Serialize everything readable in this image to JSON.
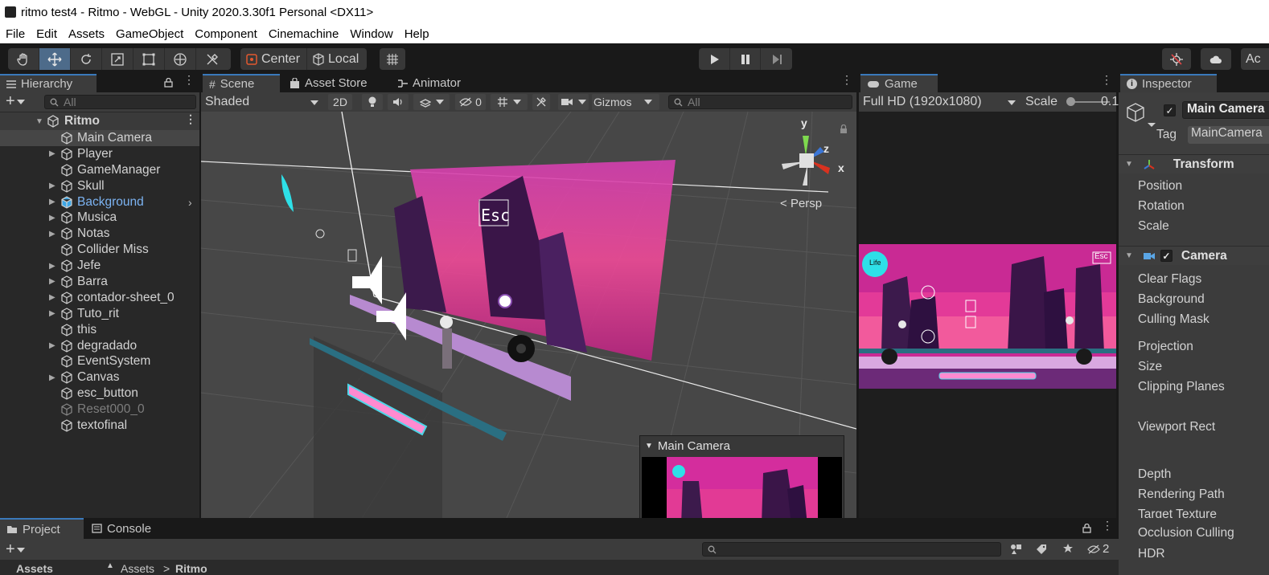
{
  "window": {
    "title": "ritmo test4 - Ritmo - WebGL - Unity 2020.3.30f1 Personal <DX11>"
  },
  "menu": [
    "File",
    "Edit",
    "Assets",
    "GameObject",
    "Component",
    "Cinemachine",
    "Window",
    "Help"
  ],
  "toolbar": {
    "tools": [
      "hand-tool",
      "move-tool",
      "rotate-tool",
      "scale-tool",
      "rect-tool",
      "transform-tool",
      "custom-tool"
    ],
    "active_tool": "move-tool",
    "pivot_label": "Center",
    "space_label": "Local",
    "account_label": "Ac"
  },
  "hierarchy": {
    "tab": "Hierarchy",
    "search_placeholder": "All",
    "scene": "Ritmo",
    "items": [
      {
        "label": "Main Camera",
        "fold": false
      },
      {
        "label": "Player",
        "fold": true
      },
      {
        "label": "GameManager",
        "fold": false
      },
      {
        "label": "Skull",
        "fold": true
      },
      {
        "label": "Background",
        "fold": true
      },
      {
        "label": "Musica",
        "fold": true
      },
      {
        "label": "Notas",
        "fold": true
      },
      {
        "label": "Collider Miss",
        "fold": false
      },
      {
        "label": "Jefe",
        "fold": true
      },
      {
        "label": "Barra",
        "fold": true
      },
      {
        "label": "contador-sheet_0",
        "fold": true
      },
      {
        "label": "Tuto_rit",
        "fold": true
      },
      {
        "label": "this",
        "fold": false
      },
      {
        "label": "degradado",
        "fold": true
      },
      {
        "label": "EventSystem",
        "fold": false
      },
      {
        "label": "Canvas",
        "fold": true
      },
      {
        "label": "esc_button",
        "fold": false
      },
      {
        "label": "Reset000_0",
        "fold": false
      },
      {
        "label": "textofinal",
        "fold": false
      }
    ]
  },
  "scene": {
    "tabs": [
      "Scene",
      "Asset Store",
      "Animator"
    ],
    "shading": "Shaded",
    "mode_2d": "2D",
    "hidden_count": "0",
    "gizmos": "Gizmos",
    "search_placeholder": "All",
    "persp_label": "Persp",
    "axis_y": "y",
    "axis_z": "z",
    "axis_x": "x",
    "esc_text": "Esc",
    "camera_preview_title": "Main Camera"
  },
  "game": {
    "tab": "Game",
    "resolution": "Full HD (1920x1080)",
    "scale_label": "Scale",
    "scale_value": "0.1",
    "life_label": "Life",
    "esc_text": "Esc"
  },
  "inspector": {
    "tab": "Inspector",
    "object_name": "Main Camera",
    "tag_label": "Tag",
    "tag_value": "MainCamera",
    "transform": {
      "title": "Transform",
      "fields": [
        "Position",
        "Rotation",
        "Scale"
      ]
    },
    "camera": {
      "title": "Camera",
      "fields": [
        "Clear Flags",
        "Background",
        "Culling Mask",
        "Projection",
        "Size",
        "Clipping Planes",
        "Viewport Rect",
        "Depth",
        "Rendering Path",
        "Target Texture",
        "Occlusion Culling",
        "HDR"
      ]
    }
  },
  "bottom": {
    "tabs": [
      "Project",
      "Console"
    ],
    "hidden_count": "2",
    "breadcrumb": [
      "Assets",
      "Ritmo"
    ],
    "left_crumb": "Assets"
  },
  "colors": {
    "accent": "#3a79bb",
    "selected_blue": "#7cb3f2",
    "magenta": "#e02a9a",
    "cyan": "#2ee0e8"
  }
}
